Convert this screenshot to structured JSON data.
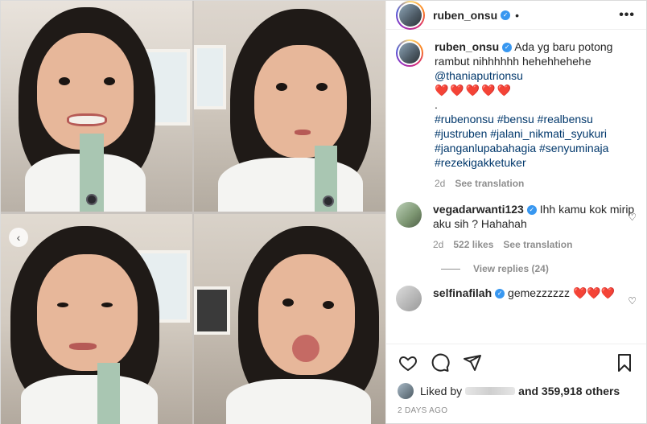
{
  "post": {
    "username": "ruben_onsu",
    "separator": "•",
    "more": "•••"
  },
  "caption": {
    "username": "ruben_onsu",
    "text": "Ada yg baru potong rambut nihhhhhh hehehhehehe",
    "mention": "@thaniaputrionsu",
    "hearts": "❤️❤️❤️❤️❤️",
    "dot": ".",
    "hashtags": "#rubenonsu #bensu #realbensu #justruben #jalani_nikmati_syukuri #janganlupabahagia #senyuminaja #rezekigakketuker",
    "age": "2d",
    "see_translation": "See translation"
  },
  "comments": [
    {
      "username": "vegadarwanti123",
      "text": "Ihh kamu kok mirip aku sih ? Hahahah",
      "age": "2d",
      "likes": "522 likes",
      "see_translation": "See translation",
      "view_replies": "View replies (24)"
    },
    {
      "username": "selfinafilah",
      "text": "gemezzzzzz ❤️❤️❤️"
    }
  ],
  "likes": {
    "prefix": "Liked by",
    "suffix": "and 359,918 others"
  },
  "timestamp": "2 DAYS AGO",
  "colors": {
    "verified": "#3897f0",
    "heart": "#ed4956",
    "link": "#00376b"
  }
}
